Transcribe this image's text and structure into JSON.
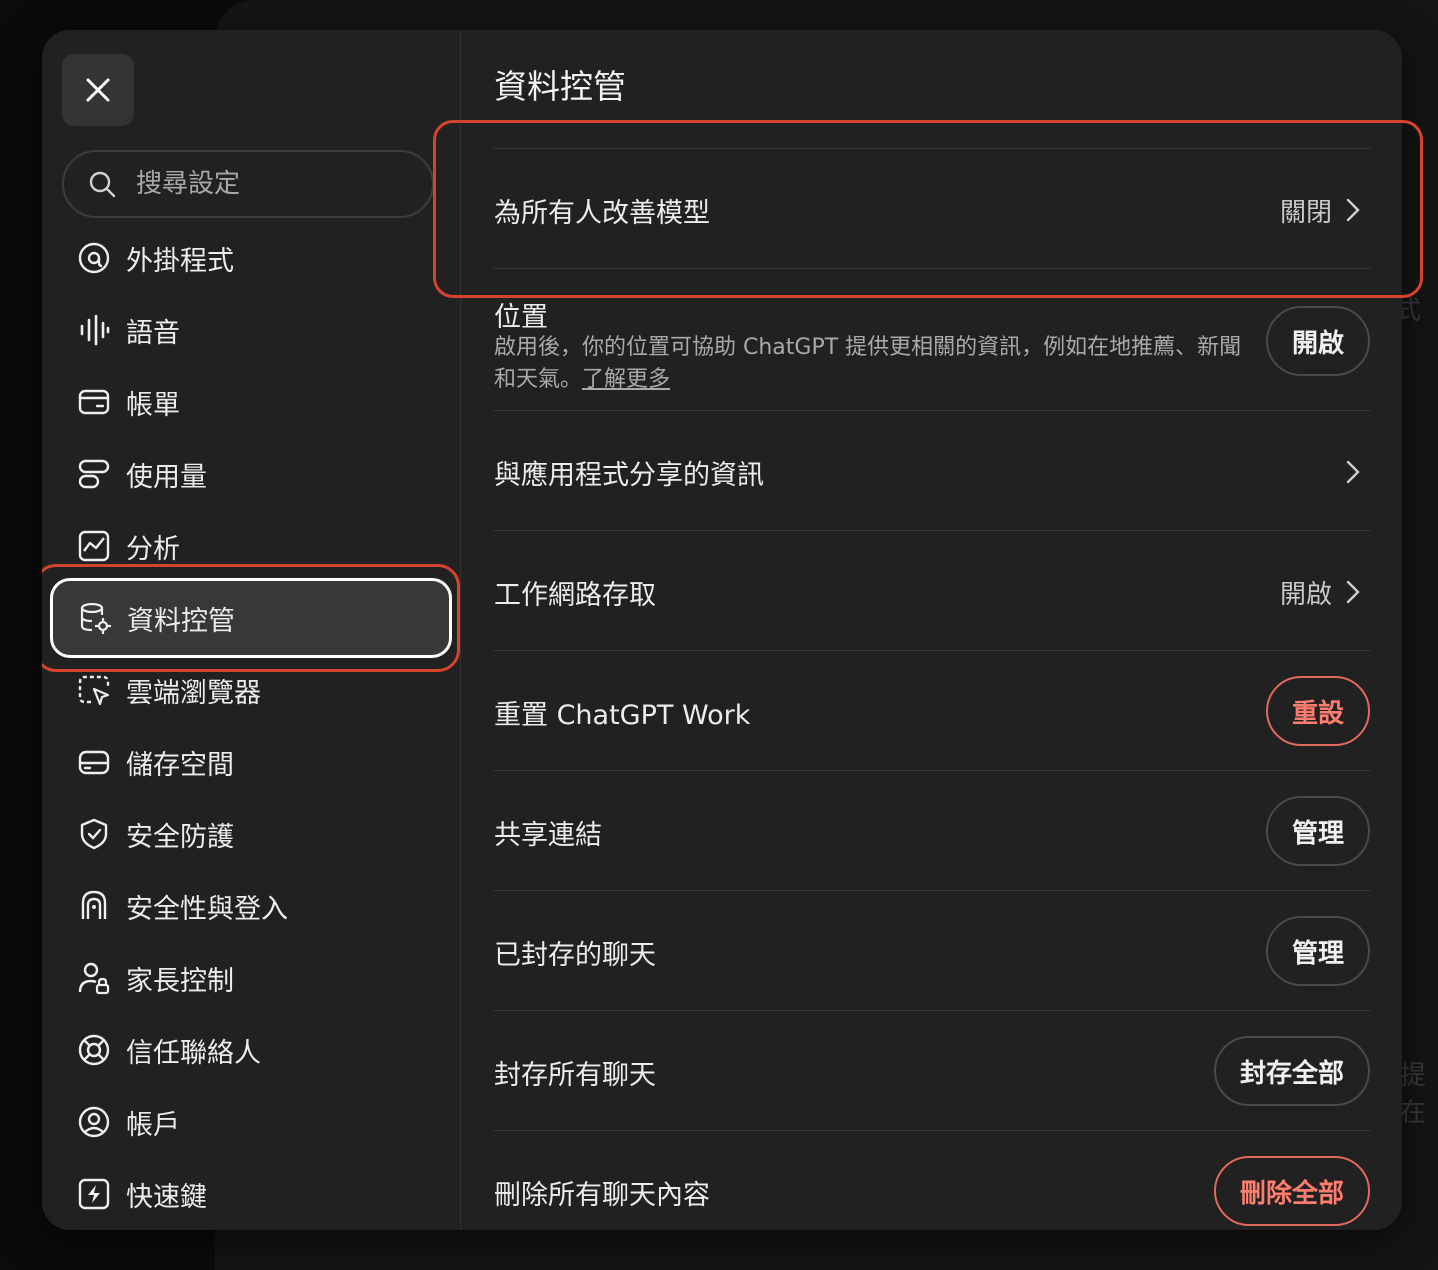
{
  "backdrop": {
    "ghost_text_1": "式",
    "ghost_text_2": "提在"
  },
  "sidebar": {
    "close_label": "close",
    "search_placeholder": "搜尋設定",
    "items": [
      {
        "label": "外掛程式",
        "icon": "plugin-icon"
      },
      {
        "label": "語音",
        "icon": "waveform-icon"
      },
      {
        "label": "帳單",
        "icon": "credit-card-icon"
      },
      {
        "label": "使用量",
        "icon": "usage-icon"
      },
      {
        "label": "分析",
        "icon": "analytics-icon"
      },
      {
        "label": "資料控管",
        "icon": "database-gear-icon",
        "active": true
      },
      {
        "label": "雲端瀏覽器",
        "icon": "browser-cursor-icon"
      },
      {
        "label": "儲存空間",
        "icon": "storage-icon"
      },
      {
        "label": "安全防護",
        "icon": "shield-icon"
      },
      {
        "label": "安全性與登入",
        "icon": "lock-face-icon"
      },
      {
        "label": "家長控制",
        "icon": "parent-lock-icon"
      },
      {
        "label": "信任聯絡人",
        "icon": "lifebuoy-icon"
      },
      {
        "label": "帳戶",
        "icon": "user-circle-icon"
      },
      {
        "label": "快速鍵",
        "icon": "lightning-icon"
      }
    ]
  },
  "content": {
    "title": "資料控管",
    "improve_model": {
      "label": "為所有人改善模型",
      "value": "關閉"
    },
    "location": {
      "label": "位置",
      "description": "啟用後，你的位置可協助 ChatGPT 提供更相關的資訊，例如在地推薦、新聞和天氣。",
      "link": "了解更多",
      "button": "開啟"
    },
    "app_sharing": {
      "label": "與應用程式分享的資訊"
    },
    "work_network": {
      "label": "工作網路存取",
      "value": "開啟"
    },
    "reset_work": {
      "label": "重置 ChatGPT Work",
      "button": "重設"
    },
    "shared_links": {
      "label": "共享連結",
      "button": "管理"
    },
    "archived_chats": {
      "label": "已封存的聊天",
      "button": "管理"
    },
    "archive_all": {
      "label": "封存所有聊天",
      "button": "封存全部"
    },
    "delete_all": {
      "label": "刪除所有聊天內容",
      "button": "刪除全部"
    }
  }
}
